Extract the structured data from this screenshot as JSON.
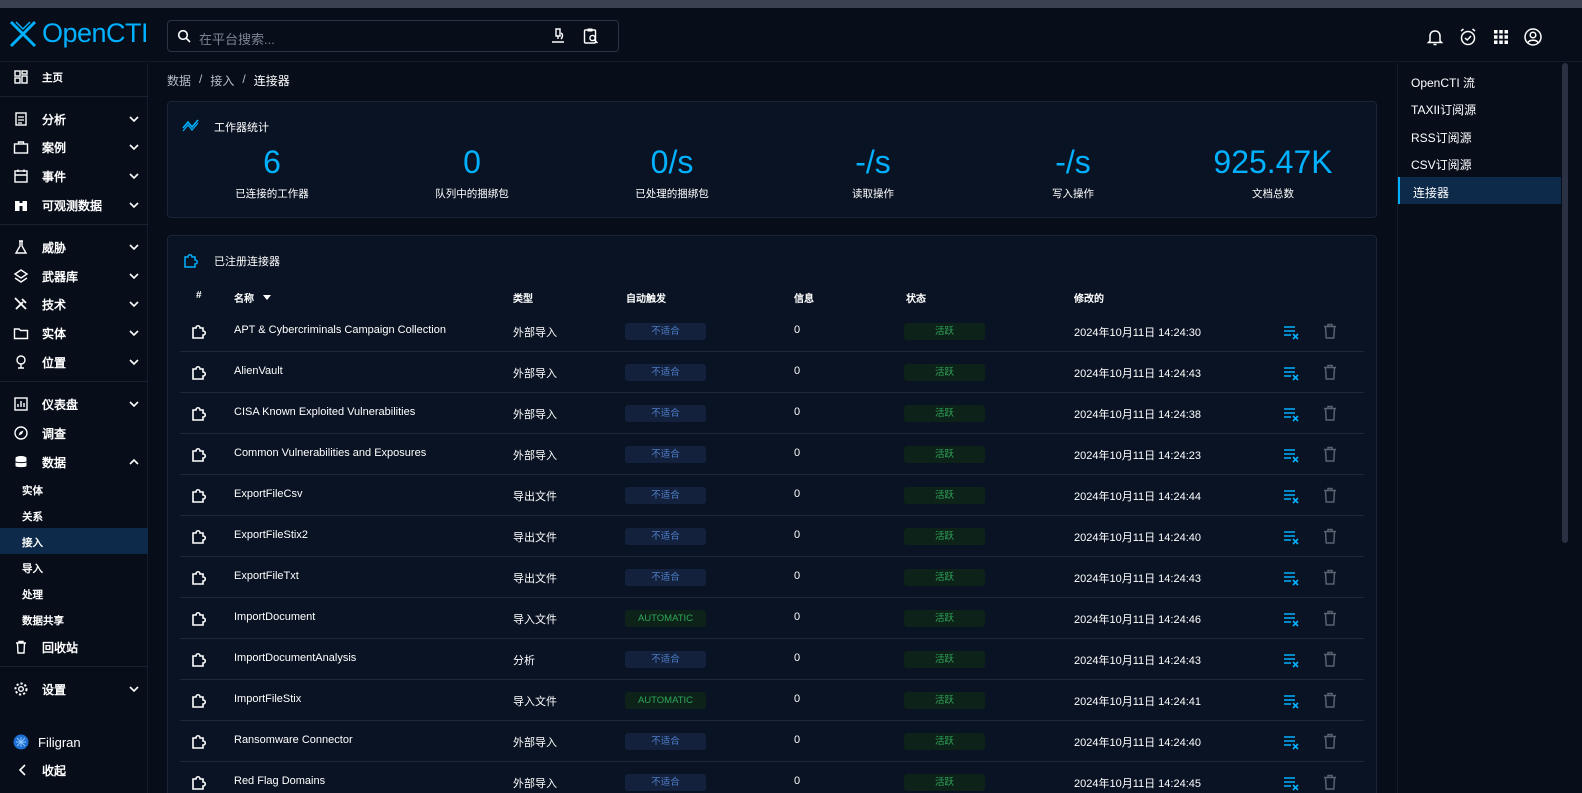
{
  "app": {
    "name": "OpenCTI"
  },
  "search": {
    "placeholder": "在平台搜索..."
  },
  "sidebar": {
    "home": "主页",
    "groups": [
      {
        "label": "分析"
      },
      {
        "label": "案例"
      },
      {
        "label": "事件"
      },
      {
        "label": "可观测数据"
      },
      {
        "label": "威胁"
      },
      {
        "label": "武器库"
      },
      {
        "label": "技术"
      },
      {
        "label": "实体"
      },
      {
        "label": "位置"
      },
      {
        "label": "仪表盘"
      },
      {
        "label": "调查"
      },
      {
        "label": "数据"
      }
    ],
    "data_sub": [
      {
        "label": "实体"
      },
      {
        "label": "关系"
      },
      {
        "label": "接入",
        "active": true
      },
      {
        "label": "导入"
      },
      {
        "label": "处理"
      },
      {
        "label": "数据共享"
      }
    ],
    "trash": "回收站",
    "settings": "设置",
    "brand": "Filigran",
    "collapse": "收起"
  },
  "breadcrumb": {
    "items": [
      "数据",
      "接入"
    ],
    "current": "连接器"
  },
  "workers": {
    "title": "工作器统计",
    "stats": [
      {
        "value": "6",
        "label": "已连接的工作器"
      },
      {
        "value": "0",
        "label": "队列中的捆绑包"
      },
      {
        "value": "0/s",
        "label": "已处理的捆绑包"
      },
      {
        "value": "-/s",
        "label": "读取操作"
      },
      {
        "value": "-/s",
        "label": "写入操作"
      },
      {
        "value": "925.47K",
        "label": "文档总数"
      }
    ]
  },
  "connectors": {
    "title": "已注册连接器",
    "headers": {
      "num": "#",
      "name": "名称",
      "type": "类型",
      "trigger": "自动触发",
      "info": "信息",
      "status": "状态",
      "modified": "修改的"
    },
    "rows": [
      {
        "name": "APT & Cybercriminals Campaign Collection",
        "type": "外部导入",
        "trigger": "不适合",
        "trigger_kind": "na",
        "info": "0",
        "status": "活跃",
        "modified": "2024年10月11日 14:24:30"
      },
      {
        "name": "AlienVault",
        "type": "外部导入",
        "trigger": "不适合",
        "trigger_kind": "na",
        "info": "0",
        "status": "活跃",
        "modified": "2024年10月11日 14:24:43"
      },
      {
        "name": "CISA Known Exploited Vulnerabilities",
        "type": "外部导入",
        "trigger": "不适合",
        "trigger_kind": "na",
        "info": "0",
        "status": "活跃",
        "modified": "2024年10月11日 14:24:38"
      },
      {
        "name": "Common Vulnerabilities and Exposures",
        "type": "外部导入",
        "trigger": "不适合",
        "trigger_kind": "na",
        "info": "0",
        "status": "活跃",
        "modified": "2024年10月11日 14:24:23"
      },
      {
        "name": "ExportFileCsv",
        "type": "导出文件",
        "trigger": "不适合",
        "trigger_kind": "na",
        "info": "0",
        "status": "活跃",
        "modified": "2024年10月11日 14:24:44"
      },
      {
        "name": "ExportFileStix2",
        "type": "导出文件",
        "trigger": "不适合",
        "trigger_kind": "na",
        "info": "0",
        "status": "活跃",
        "modified": "2024年10月11日 14:24:40"
      },
      {
        "name": "ExportFileTxt",
        "type": "导出文件",
        "trigger": "不适合",
        "trigger_kind": "na",
        "info": "0",
        "status": "活跃",
        "modified": "2024年10月11日 14:24:43"
      },
      {
        "name": "ImportDocument",
        "type": "导入文件",
        "trigger": "AUTOMATIC",
        "trigger_kind": "auto",
        "info": "0",
        "status": "活跃",
        "modified": "2024年10月11日 14:24:46"
      },
      {
        "name": "ImportDocumentAnalysis",
        "type": "分析",
        "trigger": "不适合",
        "trigger_kind": "na",
        "info": "0",
        "status": "活跃",
        "modified": "2024年10月11日 14:24:43"
      },
      {
        "name": "ImportFileStix",
        "type": "导入文件",
        "trigger": "AUTOMATIC",
        "trigger_kind": "auto",
        "info": "0",
        "status": "活跃",
        "modified": "2024年10月11日 14:24:41"
      },
      {
        "name": "Ransomware Connector",
        "type": "外部导入",
        "trigger": "不适合",
        "trigger_kind": "na",
        "info": "0",
        "status": "活跃",
        "modified": "2024年10月11日 14:24:40"
      },
      {
        "name": "Red Flag Domains",
        "type": "外部导入",
        "trigger": "不适合",
        "trigger_kind": "na",
        "info": "0",
        "status": "活跃",
        "modified": "2024年10月11日 14:24:45"
      }
    ]
  },
  "rightnav": {
    "items": [
      {
        "label": "OpenCTI 流"
      },
      {
        "label": "TAXII订阅源"
      },
      {
        "label": "RSS订阅源"
      },
      {
        "label": "CSV订阅源"
      },
      {
        "label": "连接器",
        "active": true
      }
    ]
  },
  "colors": {
    "accent": "#00b1ff",
    "active_bg": "#0d2a4a",
    "status_green": "#2fa85a",
    "na_blue": "#4f7fc8"
  }
}
